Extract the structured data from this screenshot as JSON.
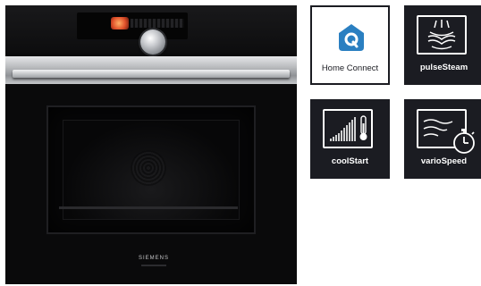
{
  "oven": {
    "brand": "SIEMENS"
  },
  "features": [
    {
      "label": "Home Connect",
      "icon": "home-connect-icon"
    },
    {
      "label": "pulseSteam",
      "icon": "steam-icon"
    },
    {
      "label": "coolStart",
      "icon": "cool-start-icon"
    },
    {
      "label": "varioSpeed",
      "icon": "vario-speed-icon"
    }
  ],
  "colors": {
    "tile_dark": "#1b1c22",
    "home_connect_blue": "#2a7fc1"
  }
}
